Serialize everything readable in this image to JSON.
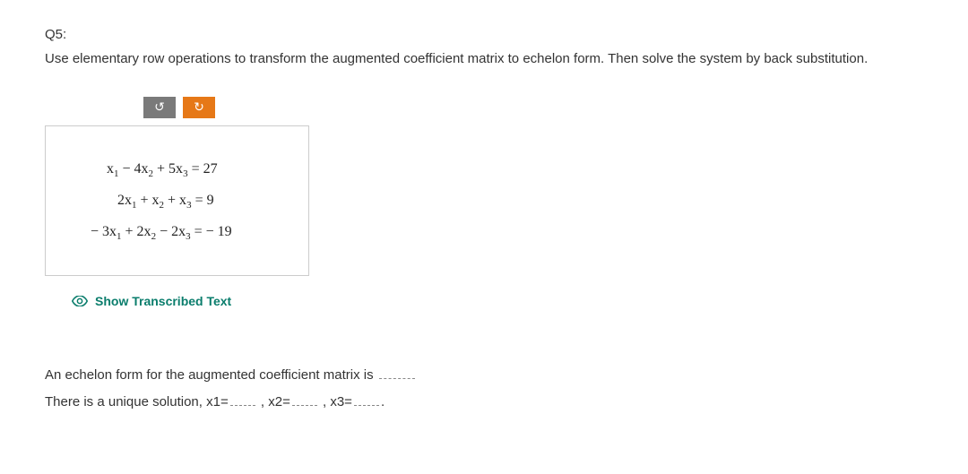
{
  "question": {
    "label": "Q5:",
    "text": "Use elementary row operations to transform the augmented coefficient matrix to echelon form. Then solve the system by back substitution."
  },
  "buttons": {
    "undo": "↺",
    "redo": "↻"
  },
  "equations": {
    "eq1": {
      "lhs_pre": "x",
      "sub1": "1",
      "mid1": " − 4x",
      "sub2": "2",
      "mid2": " + 5x",
      "sub3": "3",
      "rhs": " = 27"
    },
    "eq2": {
      "lhs_pre": "2x",
      "sub1": "1",
      "mid1": " + x",
      "sub2": "2",
      "mid2": " + x",
      "sub3": "3",
      "rhs": " = 9"
    },
    "eq3": {
      "lhs_pre": "− 3x",
      "sub1": "1",
      "mid1": " + 2x",
      "sub2": "2",
      "mid2": " − 2x",
      "sub3": "3",
      "rhs": " = − 19"
    }
  },
  "transcribed_link": "Show Transcribed Text",
  "answers": {
    "line1_pre": "An echelon form for the augmented coefficient matrix is ",
    "line2_pre": "There is a unique solution, x1=",
    "line2_mid1": " , x2=",
    "line2_mid2": " , x3=",
    "line2_end": "."
  }
}
